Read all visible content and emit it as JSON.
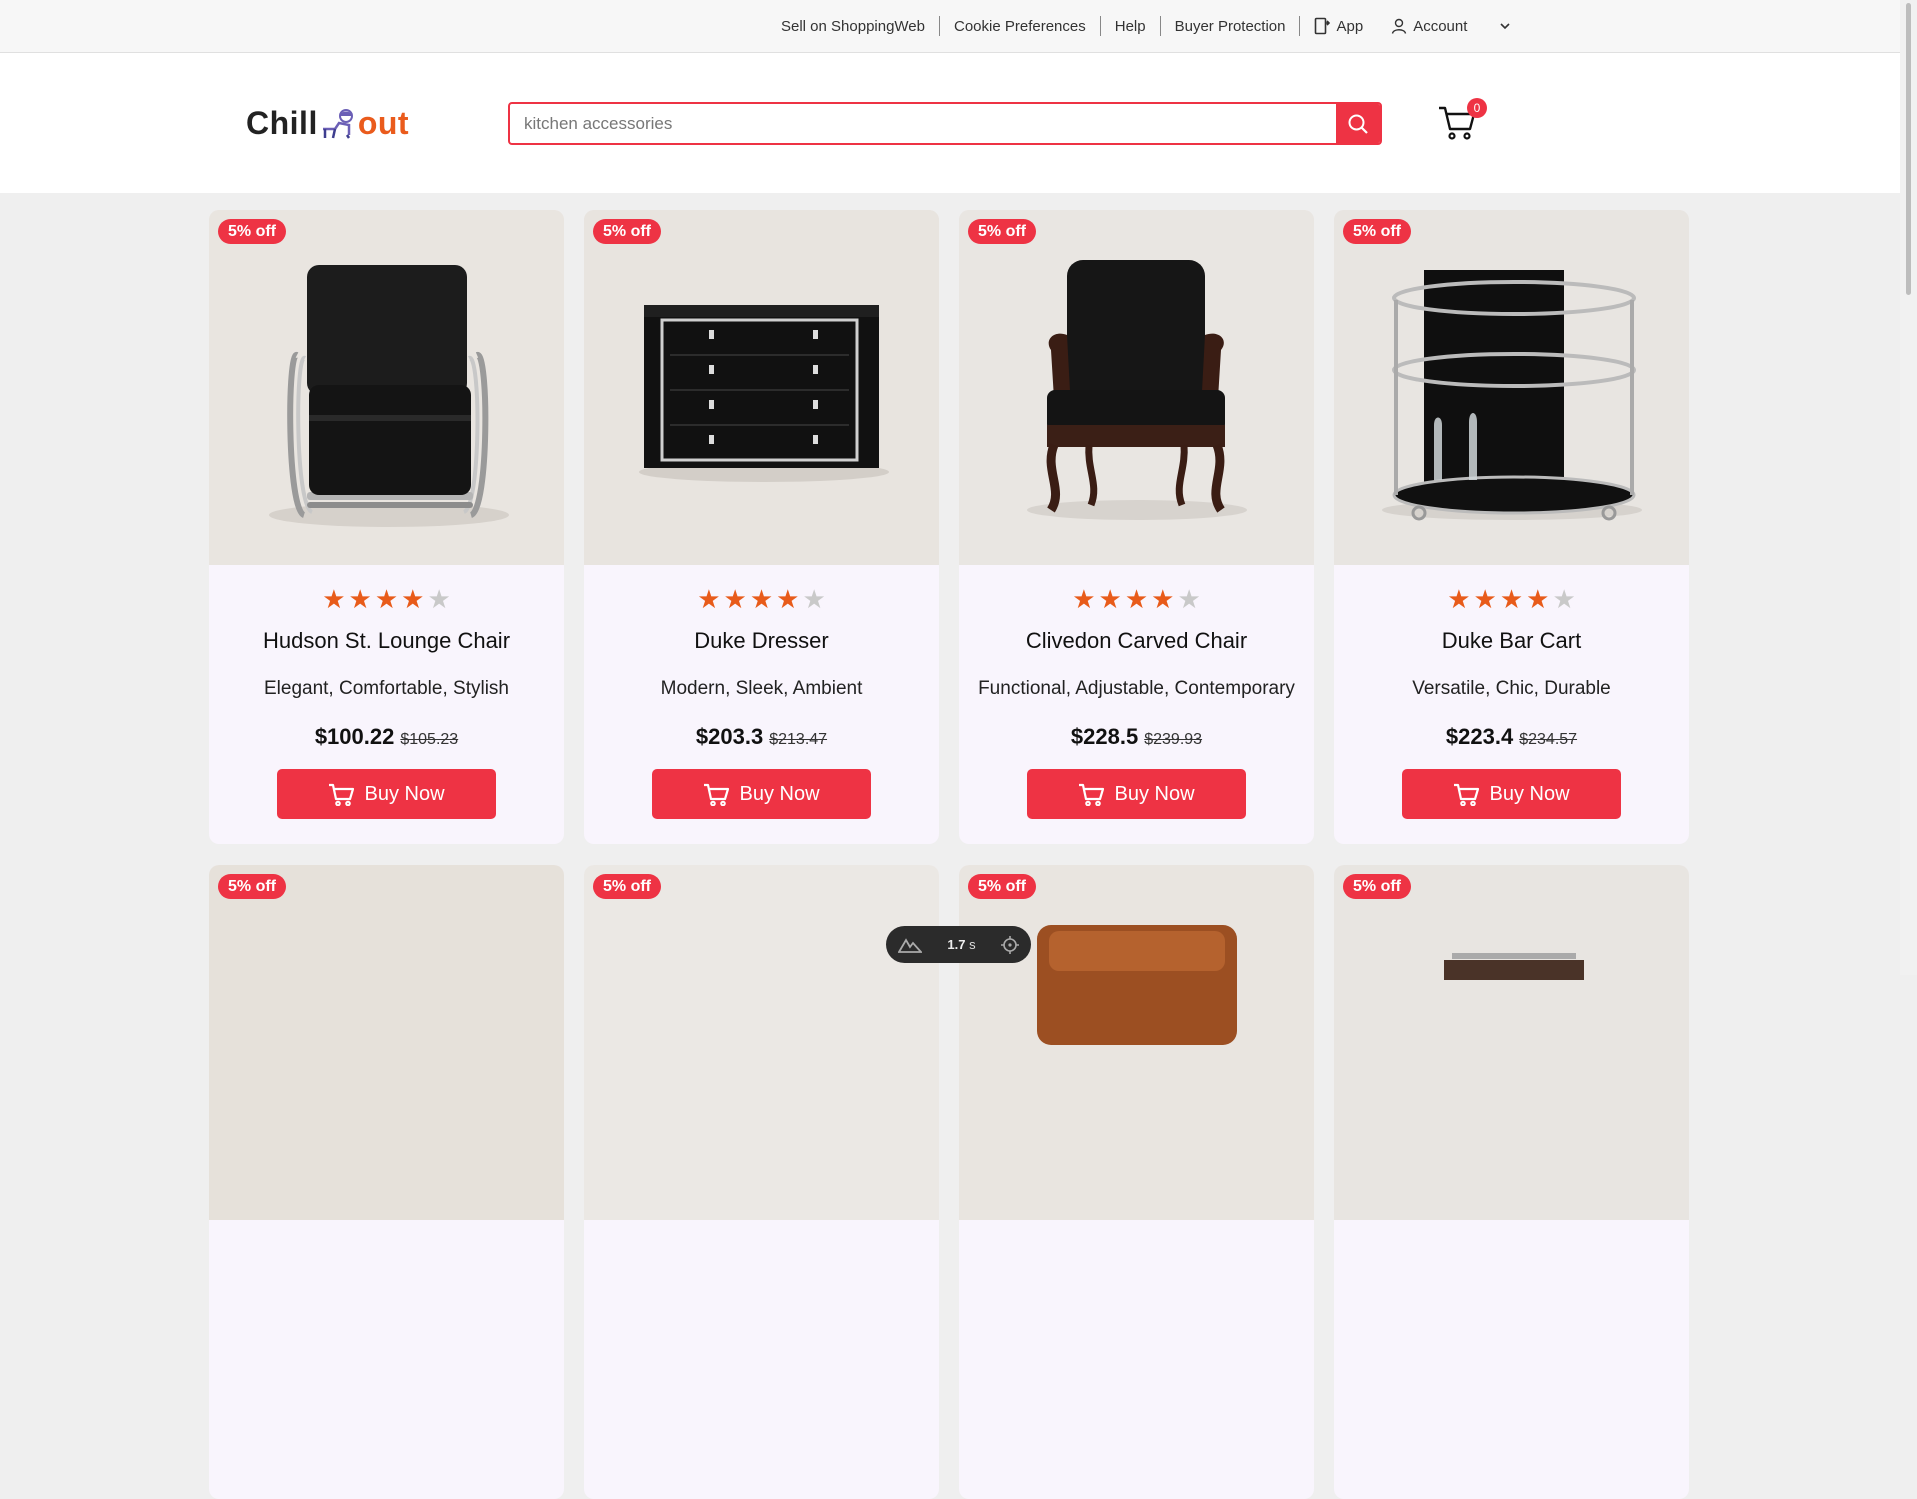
{
  "topbar": {
    "links": [
      "Sell on ShoppingWeb",
      "Cookie Preferences",
      "Help",
      "Buyer Protection"
    ],
    "app_label": "App",
    "account_label": "Account"
  },
  "logo": {
    "part1": "Chill",
    "part2": "out"
  },
  "search": {
    "placeholder": "kitchen accessories"
  },
  "cart": {
    "count": "0"
  },
  "products": [
    {
      "discount": "5% off",
      "rating": 4,
      "name": "Hudson St. Lounge Chair",
      "tags": "Elegant, Comfortable, Stylish",
      "price": "$100.22",
      "old_price": "$105.23",
      "button": "Buy Now"
    },
    {
      "discount": "5% off",
      "rating": 4,
      "name": "Duke Dresser",
      "tags": "Modern, Sleek, Ambient",
      "price": "$203.3",
      "old_price": "$213.47",
      "button": "Buy Now"
    },
    {
      "discount": "5% off",
      "rating": 4,
      "name": "Clivedon Carved Chair",
      "tags": "Functional, Adjustable, Contemporary",
      "price": "$228.5",
      "old_price": "$239.93",
      "button": "Buy Now"
    },
    {
      "discount": "5% off",
      "rating": 4,
      "name": "Duke Bar Cart",
      "tags": "Versatile, Chic, Durable",
      "price": "$223.4",
      "old_price": "$234.57",
      "button": "Buy Now"
    }
  ],
  "next_row": [
    {
      "discount": "5% off"
    },
    {
      "discount": "5% off"
    },
    {
      "discount": "5% off"
    },
    {
      "discount": "5% off"
    }
  ],
  "timer": {
    "value": "1.7",
    "unit": "s"
  },
  "colors": {
    "accent": "#ee3344",
    "star": "#e85b1a",
    "card_bg": "#f9f5fd",
    "page_bg": "#efefef"
  }
}
